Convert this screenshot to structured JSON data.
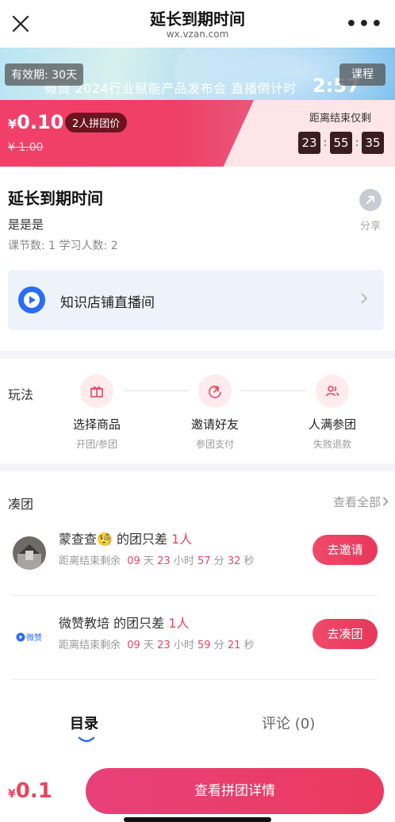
{
  "nav": {
    "title": "延长到期时间",
    "url": "wx.vzan.com",
    "more_label": "•••"
  },
  "banner": {
    "text": "微赞 2024行业赋能产品发布会 直播倒计时",
    "countdown": "2:57",
    "validity_label": "有效期: 30天",
    "type_label": "课程"
  },
  "price": {
    "currency": "¥",
    "amount": "0.10",
    "group_tag": "2人拼团价",
    "original": "¥ 1.00",
    "timer_label": "距离结束仅剩",
    "timer": [
      "23",
      "55",
      "35"
    ]
  },
  "course": {
    "title": "延长到期时间",
    "subtitle": "是是是",
    "stats": "课节数: 1   学习人数: 2",
    "share_label": "分享",
    "shop_name": "知识店铺直播间"
  },
  "rules": {
    "label": "玩法",
    "steps": [
      {
        "title": "选择商品",
        "desc": "开团/参团",
        "icon": "gift-icon"
      },
      {
        "title": "邀请好友",
        "desc": "参团支付",
        "icon": "share-arrow-icon"
      },
      {
        "title": "人满参团",
        "desc": "失败退款",
        "icon": "users-icon"
      }
    ]
  },
  "groups": {
    "heading": "凑团",
    "view_all": "查看全部",
    "items": [
      {
        "name": "蒙查查",
        "emoji": "🧐",
        "middle": " 的团只差 ",
        "need": "1人",
        "remain_prefix": "距离结束剩余",
        "days": "09",
        "hours": "23",
        "minutes": "57",
        "seconds": "32",
        "button": "去邀请"
      },
      {
        "name": "微赞教培",
        "emoji": "",
        "middle": " 的团只差 ",
        "need": "1人",
        "remain_prefix": "距离结束剩余",
        "days": "09",
        "hours": "23",
        "minutes": "59",
        "seconds": "21",
        "button": "去凑团",
        "avatar_text": "微赞"
      }
    ],
    "unit_day": "天",
    "unit_hour": "小时",
    "unit_min": "分",
    "unit_sec": "秒"
  },
  "tabs": {
    "catalog": "目录",
    "reviews": "评论 (0)"
  },
  "bottom": {
    "currency": "¥",
    "price": "0.1",
    "cta": "查看拼团详情"
  },
  "colors": {
    "accent": "#e9455f",
    "cta": "#ea3a5e"
  }
}
